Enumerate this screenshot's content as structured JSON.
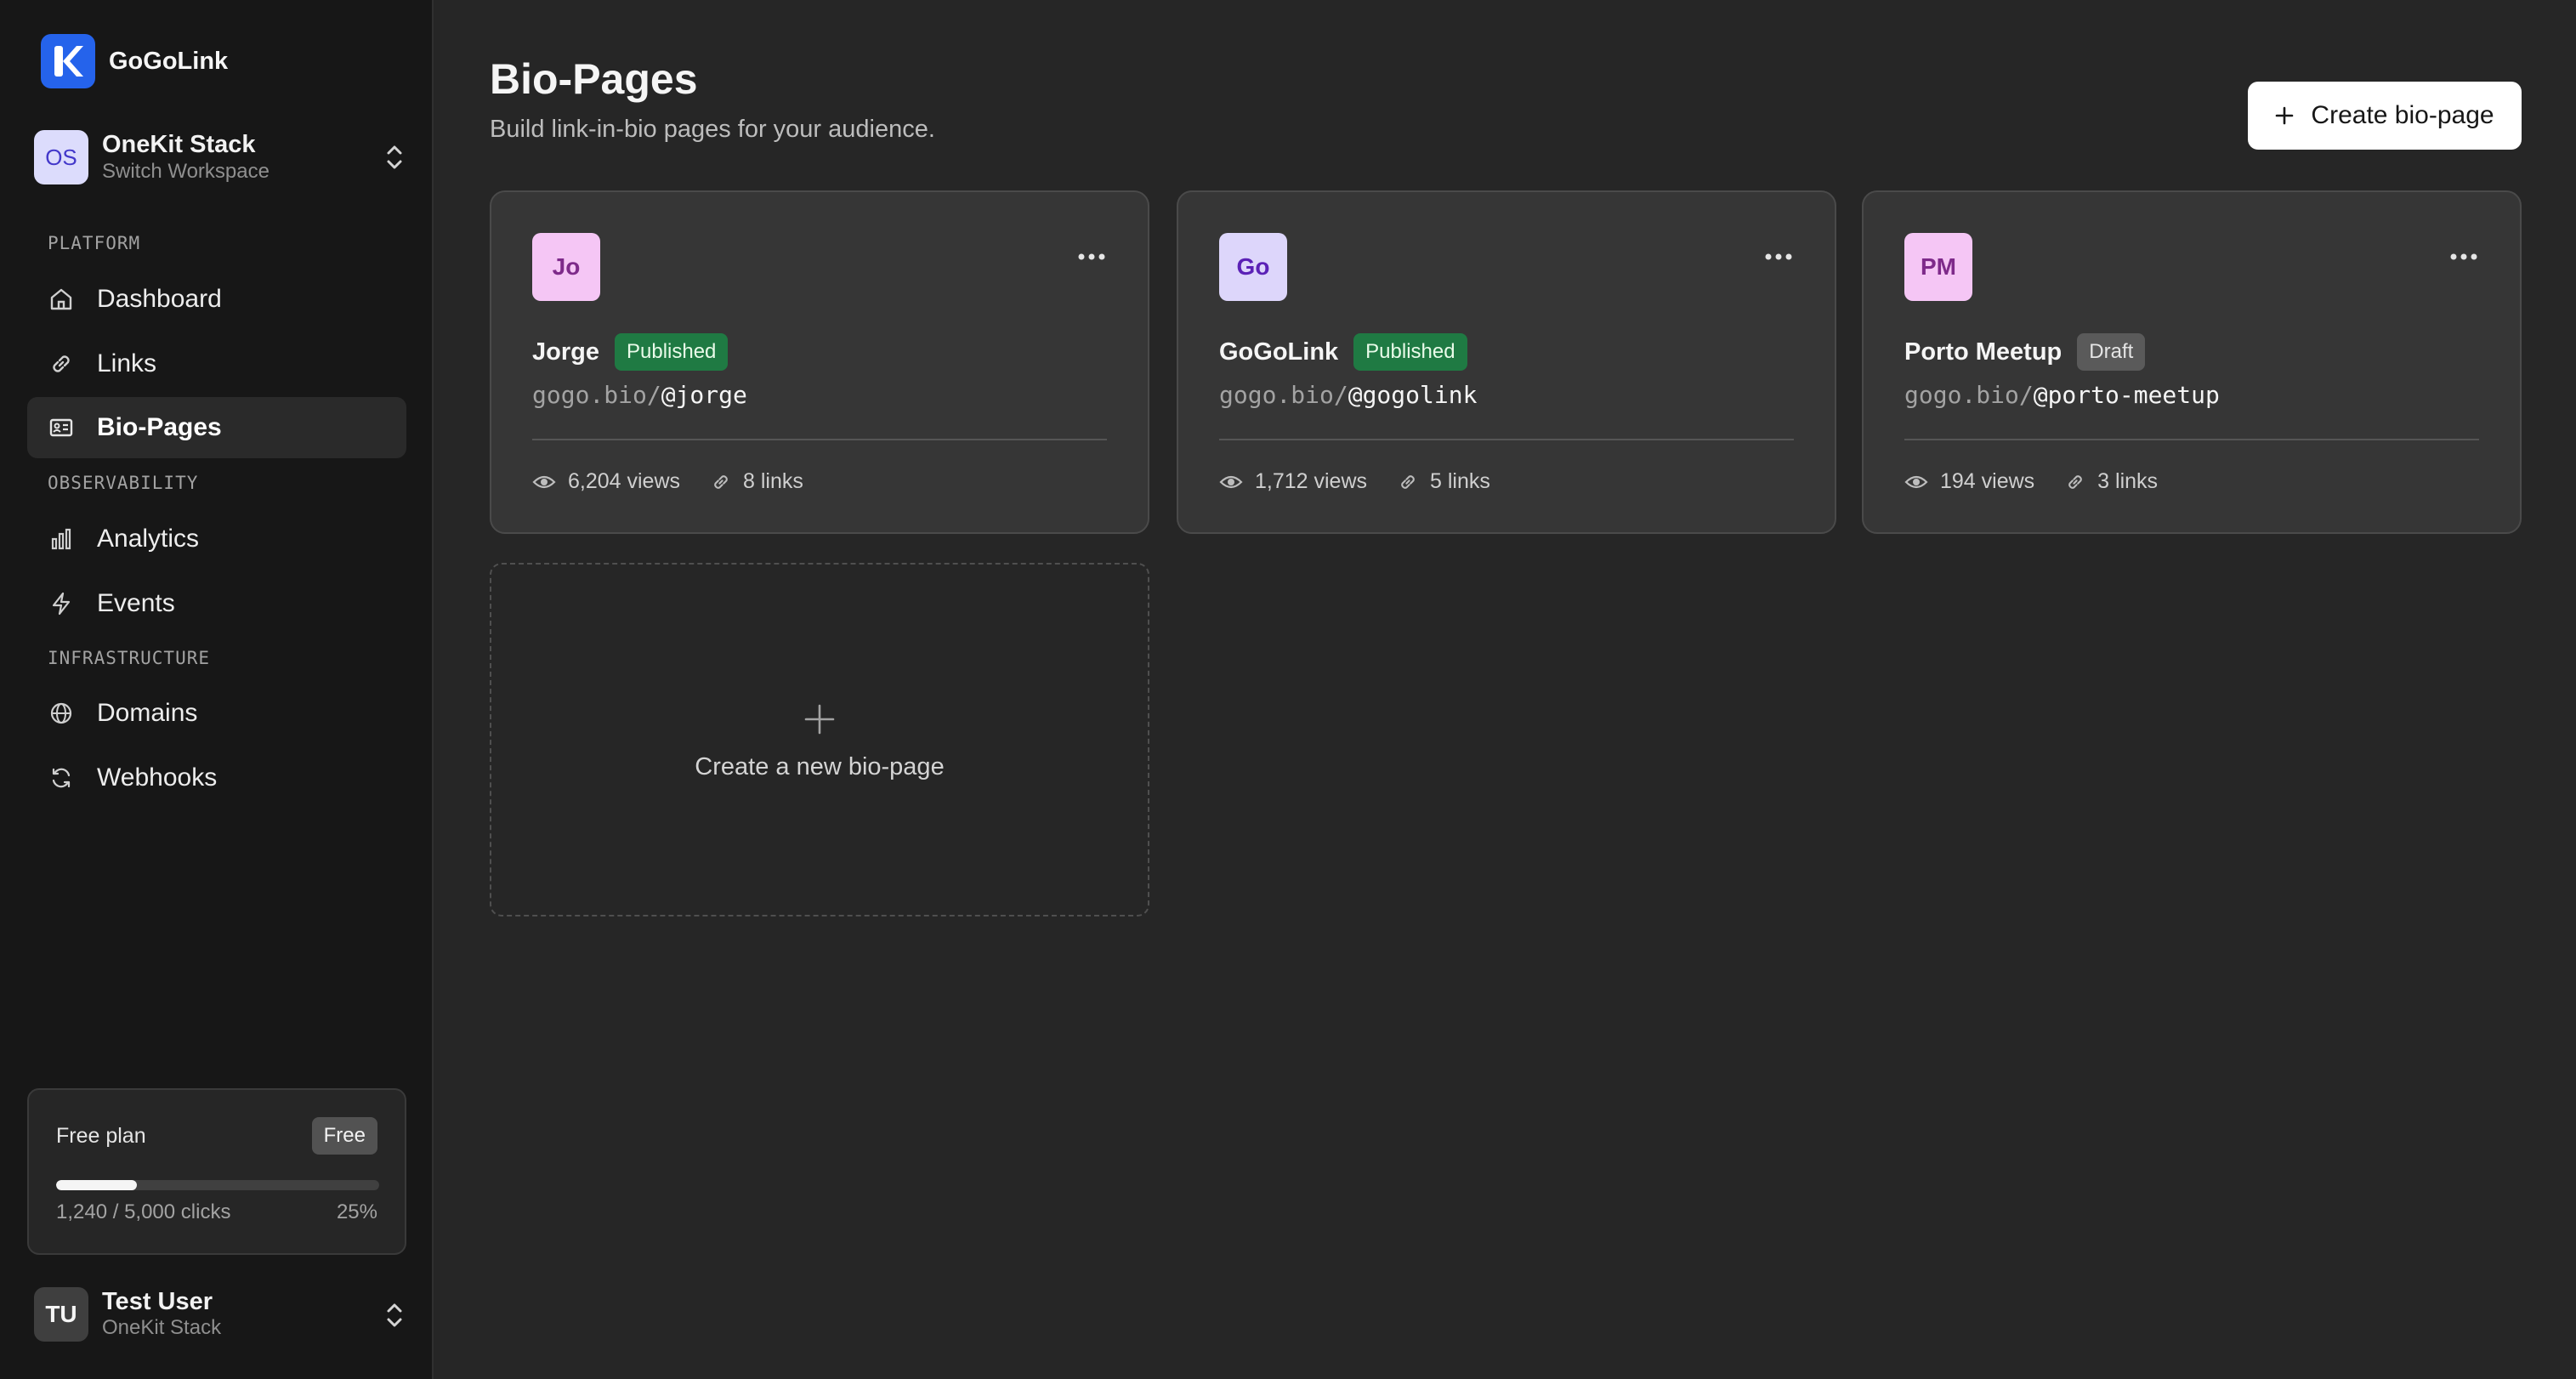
{
  "brand": {
    "name": "GoGoLink",
    "logo_letter": "K"
  },
  "workspace": {
    "initials": "OS",
    "name": "OneKit Stack",
    "subtitle": "Switch Workspace"
  },
  "sidebar": {
    "sections": [
      {
        "label": "PLATFORM"
      },
      {
        "label": "OBSERVABILITY"
      },
      {
        "label": "INFRASTRUCTURE"
      }
    ],
    "items": [
      {
        "label": "Dashboard",
        "icon": "home-icon"
      },
      {
        "label": "Links",
        "icon": "link-icon"
      },
      {
        "label": "Bio-Pages",
        "icon": "id-card-icon",
        "active": true
      },
      {
        "label": "Analytics",
        "icon": "bar-chart-icon"
      },
      {
        "label": "Events",
        "icon": "bolt-icon"
      },
      {
        "label": "Domains",
        "icon": "globe-icon"
      },
      {
        "label": "Webhooks",
        "icon": "refresh-icon"
      }
    ]
  },
  "plan": {
    "title": "Free plan",
    "badge": "Free",
    "usage": "1,240 / 5,000 clicks",
    "percent_label": "25%",
    "progress": 0.25
  },
  "user": {
    "initials": "TU",
    "name": "Test User",
    "subtitle": "OneKit Stack"
  },
  "header": {
    "title": "Bio-Pages",
    "subtitle": "Build link-in-bio pages for your audience.",
    "create_label": "Create bio-page"
  },
  "cards": [
    {
      "initials": "Jo",
      "name": "Jorge",
      "status": "Published",
      "url_prefix": "gogo.bio/",
      "handle": "@jorge",
      "views": "6,204 views",
      "links": "8 links",
      "avatar_bg": "#f5c6f5",
      "avatar_fg": "#7e2a8a"
    },
    {
      "initials": "Go",
      "name": "GoGoLink",
      "status": "Published",
      "url_prefix": "gogo.bio/",
      "handle": "@gogolink",
      "views": "1,712 views",
      "links": "5 links",
      "avatar_bg": "#ddd6fb",
      "avatar_fg": "#5b21b6"
    },
    {
      "initials": "PM",
      "name": "Porto Meetup",
      "status": "Draft",
      "url_prefix": "gogo.bio/",
      "handle": "@porto-meetup",
      "views": "194 views",
      "links": "3 links",
      "avatar_bg": "#f5c6f5",
      "avatar_fg": "#7e2a8a"
    }
  ],
  "new_card": {
    "label": "Create a new bio-page"
  },
  "colors": {
    "accent": "#2563eb",
    "published": "#1f7a43",
    "draft": "#5a5a5a"
  }
}
